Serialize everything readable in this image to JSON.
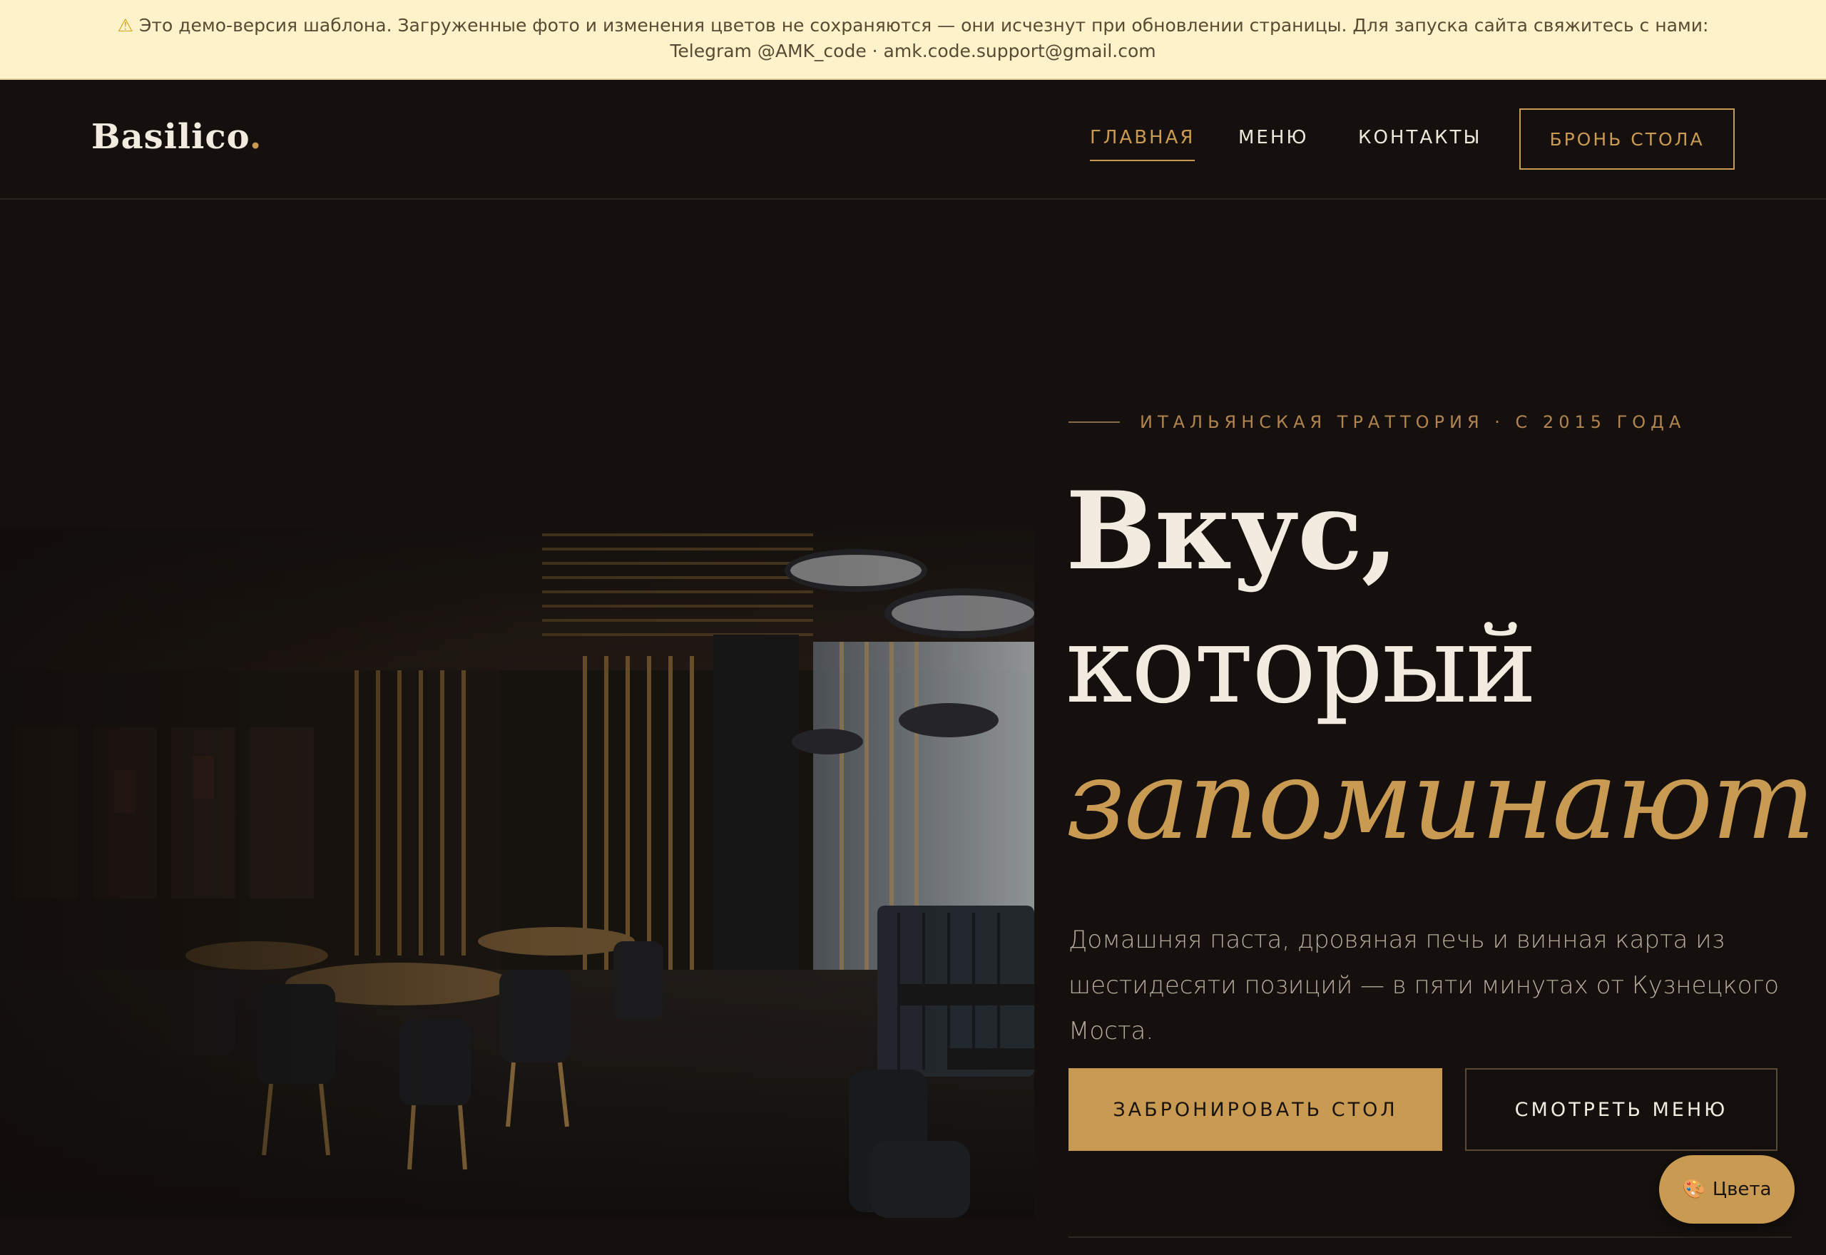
{
  "demo_banner": {
    "icon": "warning-icon",
    "text": "Это демо-версия шаблона. Загруженные фото и изменения цветов не сохраняются — они исчезнут при обновлении страницы. Для запуска сайта свяжитесь с нами: Telegram @AMK_code · amk.code.support@gmail.com"
  },
  "header": {
    "logo_text": "Basilico",
    "logo_dot": ".",
    "nav": {
      "home": "ГЛАВНАЯ",
      "menu": "МЕНЮ",
      "contacts": "КОНТАКТЫ"
    },
    "reserve_button": "БРОНЬ СТОЛА"
  },
  "hero": {
    "eyebrow": "ИТАЛЬЯНСКАЯ ТРАТТОРИЯ · С 2015 ГОДА",
    "headline_line1": "Вкус,",
    "headline_line2": "который",
    "headline_accent": "запоминают",
    "subtitle": "Домашняя паста, дровяная печь и винная карта из шестидесяти позиций — в пяти минутах от Кузнецкого Моста.",
    "primary_button": "ЗАБРОНИРОВАТЬ СТОЛ",
    "secondary_button": "СМОТРЕТЬ МЕНЮ"
  },
  "colors_widget": {
    "icon": "palette-icon",
    "label": "Цвета"
  },
  "theme": {
    "background": "#15100d",
    "accent": "#c99a52",
    "text_light": "#f2ebe0",
    "banner_bg": "#fdf2c9"
  }
}
